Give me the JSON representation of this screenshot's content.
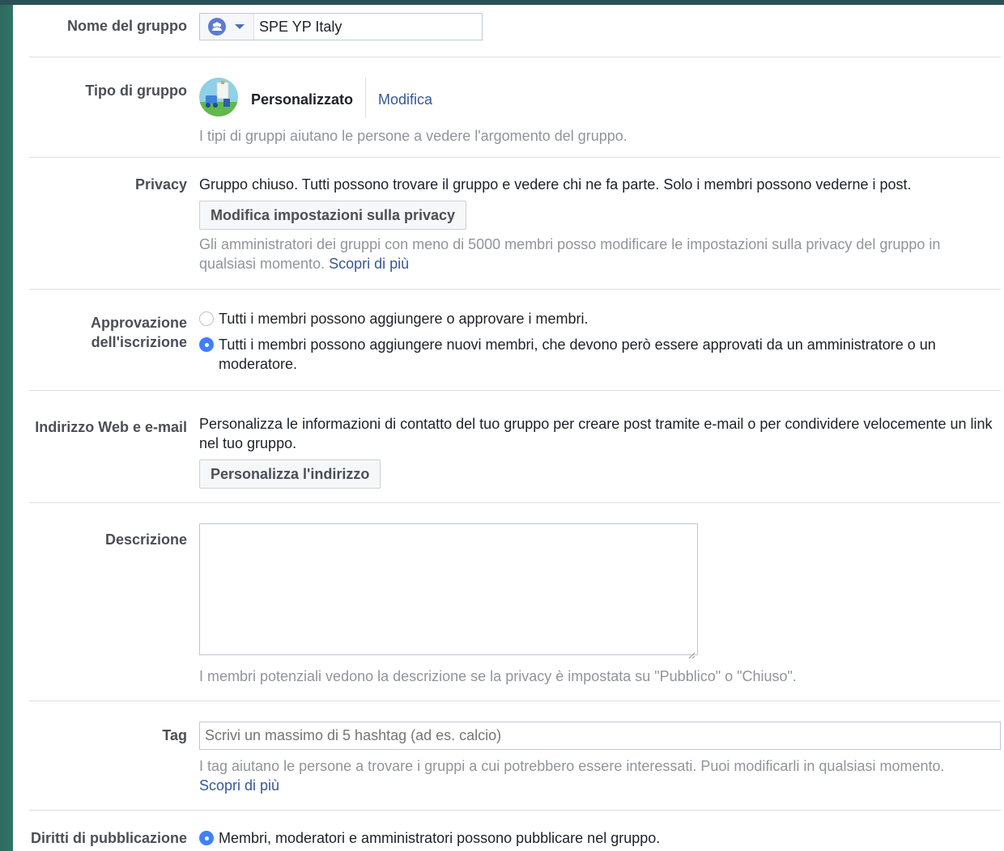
{
  "group_name": {
    "label": "Nome del gruppo",
    "value": "SPE YP Italy",
    "icon": "group-icon"
  },
  "group_type": {
    "label": "Tipo di gruppo",
    "type_name": "Personalizzato",
    "edit_link": "Modifica",
    "help": "I tipi di gruppi aiutano le persone a vedere l'argomento del gruppo."
  },
  "privacy": {
    "label": "Privacy",
    "text": "Gruppo chiuso. Tutti possono trovare il gruppo e vedere chi ne fa parte. Solo i membri possono vederne i post.",
    "button": "Modifica impostazioni sulla privacy",
    "help": "Gli amministratori dei gruppi con meno di 5000 membri posso modificare le impostazioni sulla privacy del gruppo in qualsiasi momento.",
    "learn_more": "Scopri di più"
  },
  "membership_approval": {
    "label_line1": "Approvazione",
    "label_line2": "dell'iscrizione",
    "options": [
      {
        "text": "Tutti i membri possono aggiungere o approvare i membri.",
        "selected": false
      },
      {
        "text": "Tutti i membri possono aggiungere nuovi membri, che devono però essere approvati da un amministratore o un moderatore.",
        "selected": true
      }
    ]
  },
  "web_address": {
    "label": "Indirizzo Web e e-mail",
    "text": "Personalizza le informazioni di contatto del tuo gruppo per creare post tramite e-mail o per condividere velocemente un link nel tuo gruppo.",
    "button": "Personalizza l'indirizzo"
  },
  "description": {
    "label": "Descrizione",
    "value": "",
    "help": "I membri potenziali vedono la descrizione se la privacy è impostata su \"Pubblico\" o \"Chiuso\"."
  },
  "tags": {
    "label": "Tag",
    "placeholder": "Scrivi un massimo di 5 hashtag (ad es. calcio)",
    "help": "I tag aiutano le persone a trovare i gruppi a cui potrebbero essere interessati. Puoi modificarli in qualsiasi momento.",
    "learn_more": "Scopri di più"
  },
  "posting_permissions": {
    "label": "Diritti di pubblicazione",
    "option": "Membri, moderatori e amministratori possono pubblicare nel gruppo.",
    "selected": true
  },
  "colors": {
    "link": "#365899",
    "radio_selected": "#4080ff",
    "help_text": "#90949c",
    "label_text": "#4b4f56"
  }
}
